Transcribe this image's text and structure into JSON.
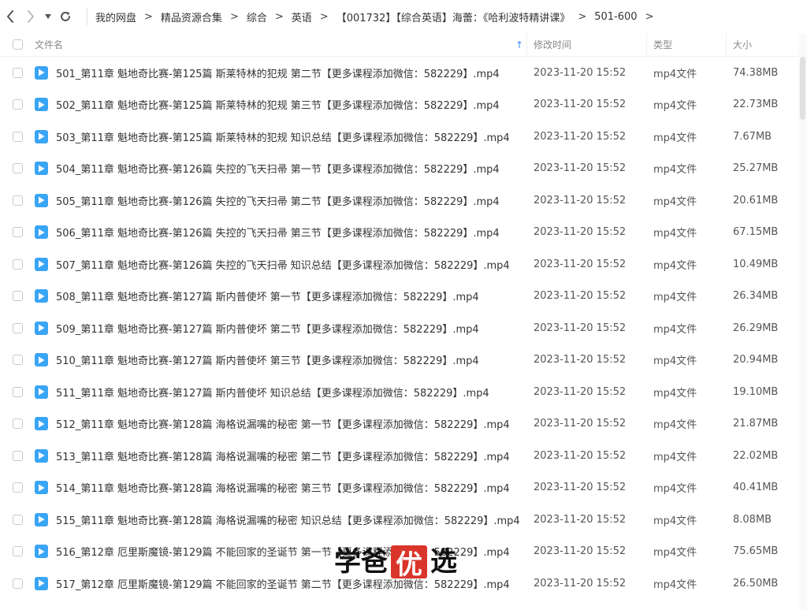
{
  "breadcrumbs": [
    "我的网盘",
    "精品资源合集",
    "综合",
    "英语",
    "【001732】【综合英语】海蕾：《哈利波特精讲课》",
    "501-600"
  ],
  "crumb_separator": ">",
  "columns": {
    "name": "文件名",
    "time": "修改时间",
    "type": "类型",
    "size": "大小"
  },
  "sort_indicator": "↑",
  "accent_color": "#3aa5f5",
  "files": [
    {
      "name": "501_第11章 魁地奇比赛-第125篇 斯莱特林的犯规 第二节【更多课程添加微信：582229】.mp4",
      "time": "2023-11-20 15:52",
      "type": "mp4文件",
      "size": "74.38MB"
    },
    {
      "name": "502_第11章 魁地奇比赛-第125篇 斯莱特林的犯规 第三节【更多课程添加微信：582229】.mp4",
      "time": "2023-11-20 15:52",
      "type": "mp4文件",
      "size": "22.73MB"
    },
    {
      "name": "503_第11章 魁地奇比赛-第125篇 斯莱特林的犯规 知识总结【更多课程添加微信：582229】.mp4",
      "time": "2023-11-20 15:52",
      "type": "mp4文件",
      "size": "7.67MB"
    },
    {
      "name": "504_第11章 魁地奇比赛-第126篇 失控的飞天扫帚 第一节【更多课程添加微信：582229】.mp4",
      "time": "2023-11-20 15:52",
      "type": "mp4文件",
      "size": "25.27MB"
    },
    {
      "name": "505_第11章 魁地奇比赛-第126篇 失控的飞天扫帚 第二节【更多课程添加微信：582229】.mp4",
      "time": "2023-11-20 15:52",
      "type": "mp4文件",
      "size": "20.61MB"
    },
    {
      "name": "506_第11章 魁地奇比赛-第126篇 失控的飞天扫帚 第三节【更多课程添加微信：582229】.mp4",
      "time": "2023-11-20 15:52",
      "type": "mp4文件",
      "size": "67.15MB"
    },
    {
      "name": "507_第11章 魁地奇比赛-第126篇 失控的飞天扫帚 知识总结【更多课程添加微信：582229】.mp4",
      "time": "2023-11-20 15:52",
      "type": "mp4文件",
      "size": "10.49MB"
    },
    {
      "name": "508_第11章 魁地奇比赛-第127篇 斯内普使坏 第一节【更多课程添加微信：582229】.mp4",
      "time": "2023-11-20 15:52",
      "type": "mp4文件",
      "size": "26.34MB"
    },
    {
      "name": "509_第11章 魁地奇比赛-第127篇 斯内普使坏 第二节【更多课程添加微信：582229】.mp4",
      "time": "2023-11-20 15:52",
      "type": "mp4文件",
      "size": "26.29MB"
    },
    {
      "name": "510_第11章 魁地奇比赛-第127篇 斯内普使坏 第三节【更多课程添加微信：582229】.mp4",
      "time": "2023-11-20 15:52",
      "type": "mp4文件",
      "size": "20.94MB"
    },
    {
      "name": "511_第11章 魁地奇比赛-第127篇 斯内普使坏 知识总结【更多课程添加微信：582229】.mp4",
      "time": "2023-11-20 15:52",
      "type": "mp4文件",
      "size": "19.10MB"
    },
    {
      "name": "512_第11章 魁地奇比赛-第128篇 海格说漏嘴的秘密 第一节【更多课程添加微信：582229】.mp4",
      "time": "2023-11-20 15:52",
      "type": "mp4文件",
      "size": "21.87MB"
    },
    {
      "name": "513_第11章 魁地奇比赛-第128篇 海格说漏嘴的秘密 第二节【更多课程添加微信：582229】.mp4",
      "time": "2023-11-20 15:52",
      "type": "mp4文件",
      "size": "22.02MB"
    },
    {
      "name": "514_第11章 魁地奇比赛-第128篇 海格说漏嘴的秘密 第三节【更多课程添加微信：582229】.mp4",
      "time": "2023-11-20 15:52",
      "type": "mp4文件",
      "size": "40.41MB"
    },
    {
      "name": "515_第11章 魁地奇比赛-第128篇 海格说漏嘴的秘密 知识总结【更多课程添加微信：582229】.mp4",
      "time": "2023-11-20 15:52",
      "type": "mp4文件",
      "size": "8.08MB"
    },
    {
      "name": "516_第12章 厄里斯魔镜-第129篇 不能回家的圣诞节 第一节【更多课程添加微信：582229】.mp4",
      "time": "2023-11-20 15:52",
      "type": "mp4文件",
      "size": "75.65MB"
    },
    {
      "name": "517_第12章 厄里斯魔镜-第129篇 不能回家的圣诞节 第二节【更多课程添加微信：582229】.mp4",
      "time": "2023-11-20 15:52",
      "type": "mp4文件",
      "size": "26.50MB"
    }
  ],
  "watermark": [
    "学",
    "爸",
    "优",
    "选"
  ]
}
